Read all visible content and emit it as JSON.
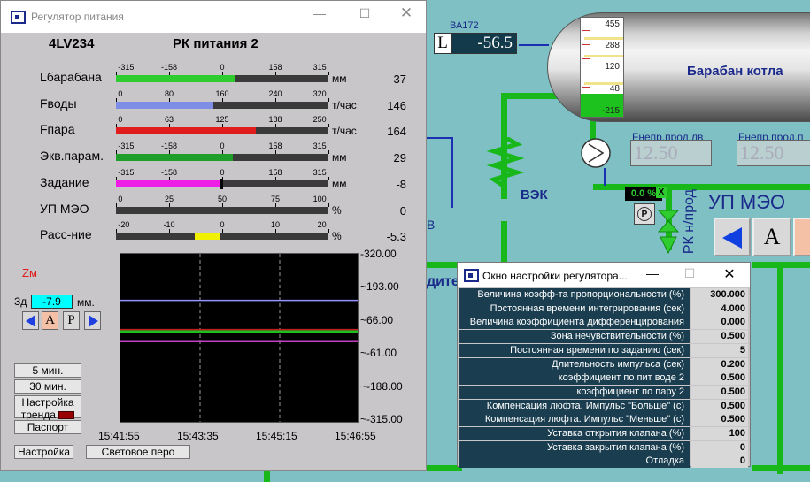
{
  "scada": {
    "tag_id": "ВА172",
    "level_letter": "L",
    "level_value": "-56.5",
    "drum_title": "Барабан котла",
    "scale_labels": [
      "455",
      "288",
      "120",
      "48",
      "-215"
    ],
    "flow_label_1": "Fнепр.прод.лв",
    "flow_label_2": "Fнепр.прод.п",
    "flow_value_1": "12.50",
    "flow_value_2": "12.50",
    "vek_label": "ВЭК",
    "percent_readout": "0.0 %",
    "x_mark": "X",
    "pump_letter": "P",
    "rk_label": "РК н/прод",
    "up_meo_label": "УП МЭО",
    "a_button": "A",
    "partial_left_1": "В",
    "partial_left_2": "дите"
  },
  "main_window": {
    "title": "Регулятор питания",
    "tag": "4LV234",
    "heading": "РК питания 2",
    "rows": [
      {
        "label": "Lбарабана",
        "ticks": [
          "-315",
          "-158",
          "0",
          "158",
          "315"
        ],
        "unit": "мм",
        "value": "37",
        "color": "#2ecc2e",
        "fill": 0.56
      },
      {
        "label": "Fводы",
        "ticks": [
          "0",
          "80",
          "160",
          "240",
          "320"
        ],
        "unit": "т/час",
        "value": "146",
        "color": "#7e8ee6",
        "fill": 0.46
      },
      {
        "label": "Fпара",
        "ticks": [
          "0",
          "63",
          "125",
          "188",
          "250"
        ],
        "unit": "т/час",
        "value": "164",
        "color": "#e01c1c",
        "fill": 0.66
      },
      {
        "label": "Экв.парам.",
        "ticks": [
          "-315",
          "-158",
          "0",
          "158",
          "315"
        ],
        "unit": "мм",
        "value": "29",
        "color": "#1f9e2a",
        "fill": 0.55
      },
      {
        "label": "Задание",
        "ticks": [
          "-315",
          "-158",
          "0",
          "158",
          "315"
        ],
        "unit": "мм",
        "value": "-8",
        "color": "#ee1ee6",
        "fill": 0.49
      },
      {
        "label": "УП МЭО",
        "ticks": [
          "0",
          "25",
          "50",
          "75",
          "100"
        ],
        "unit": "%",
        "value": "0",
        "color": "#2ecc2e",
        "fill": 0.0
      },
      {
        "label": "Расс-ние",
        "ticks": [
          "-20",
          "-10",
          "0",
          "10",
          "20"
        ],
        "unit": "%",
        "value": "-5.3",
        "color": "#f0f000",
        "fill": 0.37
      }
    ],
    "zm_label": "Zм",
    "zd_label": "Зд",
    "zd_value": "-7.9",
    "zd_unit": "мм.",
    "mode_a": "A",
    "mode_p": "P",
    "btn_5min": "5 мин.",
    "btn_30min": "30 мин.",
    "btn_trend_settings_1": "Настройка",
    "btn_trend_settings_2": "тренда",
    "btn_passport": "Паспорт",
    "btn_settings": "Настройка",
    "btn_light_pen": "Световое перо",
    "trend_y_labels": [
      "-320.00",
      "~193.00",
      "~66.00",
      "~-61.00",
      "~-188.00",
      "~-315.00"
    ],
    "trend_x_labels": [
      "15:41:55",
      "15:43:35",
      "15:45:15",
      "15:46:55"
    ],
    "chart_data": {
      "type": "line",
      "x": [
        "15:41:55",
        "15:43:35",
        "15:45:15",
        "15:46:55"
      ],
      "ylim": [
        -315,
        320
      ],
      "series": [
        {
          "color": "#c02020",
          "values": [
            37,
            37,
            37,
            37
          ]
        },
        {
          "color": "#20c020",
          "values": [
            29,
            29,
            29,
            29
          ]
        },
        {
          "color": "#9090ff",
          "values": [
            146,
            146,
            146,
            146
          ]
        },
        {
          "color": "#c040c0",
          "values": [
            -8,
            -8,
            -8,
            -8
          ]
        }
      ]
    }
  },
  "settings_dialog": {
    "title": "Окно настройки регулятора...",
    "params": [
      {
        "label": "Величина коэфф-та пропорциональности (%)",
        "value": "300.000"
      },
      {
        "label": "Постоянная времени интегрирования (сек)",
        "value": "4.000"
      },
      {
        "label": "Величина коэффициента дифференцирования",
        "value": "0.000"
      },
      {
        "label": "Зона нечувствительности (%)",
        "value": "0.500"
      },
      {
        "label": "Постоянная времени по заданию (сек)",
        "value": "5"
      },
      {
        "label": "Длительность импульса (сек)",
        "value": "0.200"
      },
      {
        "label": "коэффициент по пит воде 2",
        "value": "0.500"
      },
      {
        "label": "коэффициент по пару 2",
        "value": "0.500"
      },
      {
        "label": "Компенсация люфта. Импульс \"Больше\" (с)",
        "value": "0.500"
      },
      {
        "label": "Компенсация люфта. Импульс \"Меньше\" (с)",
        "value": "0.500"
      },
      {
        "label": "Уставка открытия клапана (%)",
        "value": "100"
      },
      {
        "label": "Уставка закрытия клапана (%)",
        "value": "0"
      },
      {
        "label": "Отладка",
        "value": "0"
      }
    ]
  }
}
